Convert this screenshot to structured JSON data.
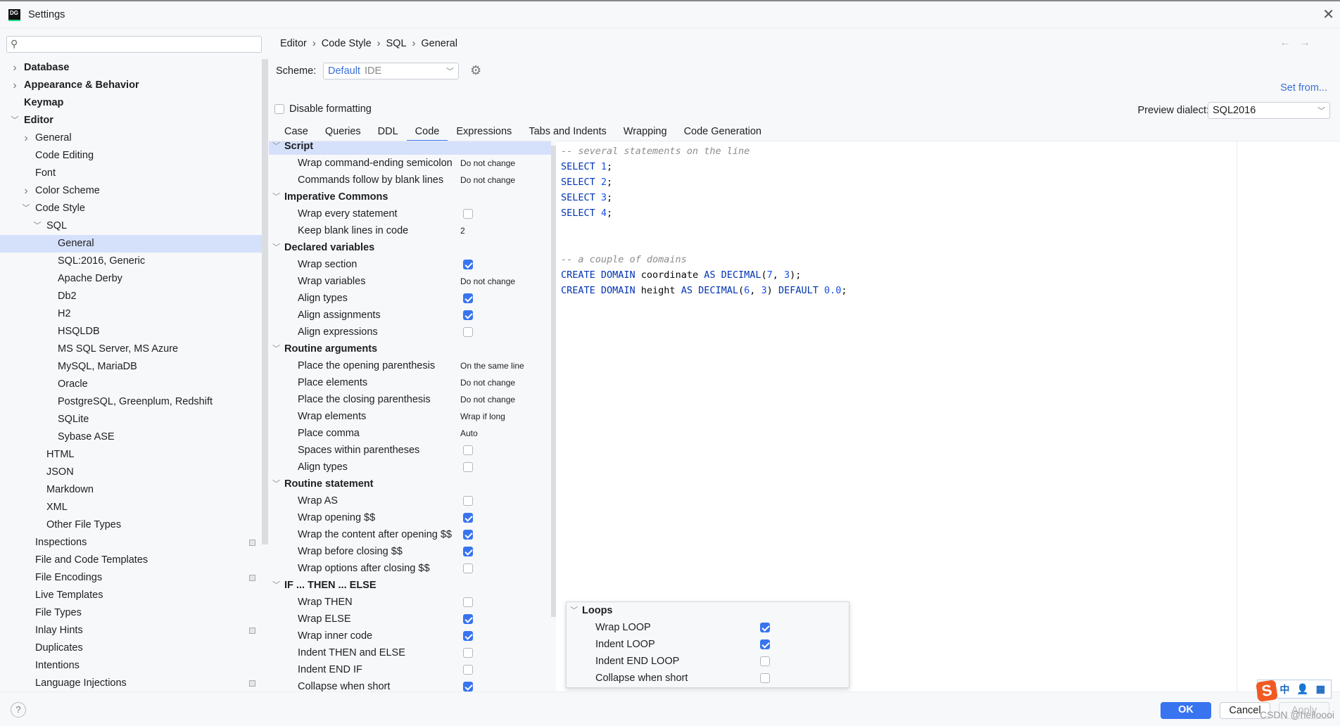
{
  "window": {
    "title": "Settings",
    "app_icon": "DG"
  },
  "search": {
    "placeholder": ""
  },
  "breadcrumb": [
    "Editor",
    "Code Style",
    "SQL",
    "General"
  ],
  "sidebar": {
    "items": [
      {
        "label": "Database",
        "level": 0,
        "arrow": "collapsed",
        "bold": true
      },
      {
        "label": "Appearance & Behavior",
        "level": 0,
        "arrow": "collapsed",
        "bold": true
      },
      {
        "label": "Keymap",
        "level": 0,
        "arrow": "none",
        "bold": true
      },
      {
        "label": "Editor",
        "level": 0,
        "arrow": "expanded",
        "bold": true
      },
      {
        "label": "General",
        "level": 1,
        "arrow": "collapsed"
      },
      {
        "label": "Code Editing",
        "level": 1,
        "arrow": "none"
      },
      {
        "label": "Font",
        "level": 1,
        "arrow": "none"
      },
      {
        "label": "Color Scheme",
        "level": 1,
        "arrow": "collapsed"
      },
      {
        "label": "Code Style",
        "level": 1,
        "arrow": "expanded"
      },
      {
        "label": "SQL",
        "level": 2,
        "arrow": "expanded"
      },
      {
        "label": "General",
        "level": 3,
        "arrow": "none",
        "selected": true
      },
      {
        "label": "SQL:2016, Generic",
        "level": 3,
        "arrow": "none"
      },
      {
        "label": "Apache Derby",
        "level": 3,
        "arrow": "none"
      },
      {
        "label": "Db2",
        "level": 3,
        "arrow": "none"
      },
      {
        "label": "H2",
        "level": 3,
        "arrow": "none"
      },
      {
        "label": "HSQLDB",
        "level": 3,
        "arrow": "none"
      },
      {
        "label": "MS SQL Server, MS Azure",
        "level": 3,
        "arrow": "none"
      },
      {
        "label": "MySQL, MariaDB",
        "level": 3,
        "arrow": "none"
      },
      {
        "label": "Oracle",
        "level": 3,
        "arrow": "none"
      },
      {
        "label": "PostgreSQL, Greenplum, Redshift",
        "level": 3,
        "arrow": "none"
      },
      {
        "label": "SQLite",
        "level": 3,
        "arrow": "none"
      },
      {
        "label": "Sybase ASE",
        "level": 3,
        "arrow": "none"
      },
      {
        "label": "HTML",
        "level": 2,
        "arrow": "none"
      },
      {
        "label": "JSON",
        "level": 2,
        "arrow": "none"
      },
      {
        "label": "Markdown",
        "level": 2,
        "arrow": "none"
      },
      {
        "label": "XML",
        "level": 2,
        "arrow": "none"
      },
      {
        "label": "Other File Types",
        "level": 2,
        "arrow": "none"
      },
      {
        "label": "Inspections",
        "level": 1,
        "arrow": "none",
        "badge": true
      },
      {
        "label": "File and Code Templates",
        "level": 1,
        "arrow": "none"
      },
      {
        "label": "File Encodings",
        "level": 1,
        "arrow": "none",
        "badge": true
      },
      {
        "label": "Live Templates",
        "level": 1,
        "arrow": "none"
      },
      {
        "label": "File Types",
        "level": 1,
        "arrow": "none"
      },
      {
        "label": "Inlay Hints",
        "level": 1,
        "arrow": "none",
        "badge": true
      },
      {
        "label": "Duplicates",
        "level": 1,
        "arrow": "none"
      },
      {
        "label": "Intentions",
        "level": 1,
        "arrow": "none"
      },
      {
        "label": "Language Injections",
        "level": 1,
        "arrow": "none",
        "badge": true
      }
    ]
  },
  "scheme": {
    "label": "Scheme:",
    "name": "Default",
    "type": "IDE"
  },
  "set_from": "Set from...",
  "disable_formatting": {
    "label": "Disable formatting",
    "checked": false
  },
  "preview_dialect": {
    "label": "Preview dialect:",
    "value": "SQL2016"
  },
  "tabs": [
    {
      "label": "Case"
    },
    {
      "label": "Queries"
    },
    {
      "label": "DDL"
    },
    {
      "label": "Code",
      "active": true
    },
    {
      "label": "Expressions"
    },
    {
      "label": "Tabs and Indents"
    },
    {
      "label": "Wrapping"
    },
    {
      "label": "Code Generation"
    }
  ],
  "options": [
    {
      "group": "Script"
    },
    {
      "label": "Wrap command-ending semicolon",
      "value": "Do not change"
    },
    {
      "label": "Commands follow by blank lines",
      "value": "Do not change"
    },
    {
      "group": "Imperative Commons"
    },
    {
      "label": "Wrap every statement",
      "checked": false
    },
    {
      "label": "Keep blank lines in code",
      "value": "2"
    },
    {
      "group": "Declared variables"
    },
    {
      "label": "Wrap section",
      "checked": true
    },
    {
      "label": "Wrap variables",
      "value": "Do not change"
    },
    {
      "label": "Align types",
      "checked": true
    },
    {
      "label": "Align assignments",
      "checked": true
    },
    {
      "label": "Align expressions",
      "checked": false
    },
    {
      "group": "Routine arguments"
    },
    {
      "label": "Place the opening parenthesis",
      "value": "On the same line"
    },
    {
      "label": "Place elements",
      "value": "Do not change"
    },
    {
      "label": "Place the closing parenthesis",
      "value": "Do not change"
    },
    {
      "label": "Wrap elements",
      "value": "Wrap if long"
    },
    {
      "label": "Place comma",
      "value": "Auto"
    },
    {
      "label": "Spaces within parentheses",
      "checked": false
    },
    {
      "label": "Align types",
      "checked": false
    },
    {
      "group": "Routine statement"
    },
    {
      "label": "Wrap AS",
      "checked": false
    },
    {
      "label": "Wrap opening $$",
      "checked": true
    },
    {
      "label": "Wrap the content after opening $$",
      "checked": true
    },
    {
      "label": "Wrap before closing $$",
      "checked": true
    },
    {
      "label": "Wrap options after closing $$",
      "checked": false
    },
    {
      "group": "IF ... THEN ... ELSE"
    },
    {
      "label": "Wrap THEN",
      "checked": false
    },
    {
      "label": "Wrap ELSE",
      "checked": true
    },
    {
      "label": "Wrap inner code",
      "checked": true
    },
    {
      "label": "Indent THEN and ELSE",
      "checked": false
    },
    {
      "label": "Indent END IF",
      "checked": false
    },
    {
      "label": "Collapse when short",
      "checked": true
    }
  ],
  "loops_popup": [
    {
      "group": "Loops"
    },
    {
      "label": "Wrap LOOP",
      "checked": true
    },
    {
      "label": "Indent LOOP",
      "checked": true
    },
    {
      "label": "Indent END LOOP",
      "checked": false
    },
    {
      "label": "Collapse when short",
      "checked": false
    }
  ],
  "preview_code": [
    [
      {
        "t": "cm",
        "v": "-- several statements on the line"
      }
    ],
    [
      {
        "t": "kw",
        "v": "SELECT "
      },
      {
        "t": "num",
        "v": "1"
      },
      {
        "t": "id",
        "v": ";"
      }
    ],
    [
      {
        "t": "kw",
        "v": "SELECT "
      },
      {
        "t": "num",
        "v": "2"
      },
      {
        "t": "id",
        "v": ";"
      }
    ],
    [
      {
        "t": "kw",
        "v": "SELECT "
      },
      {
        "t": "num",
        "v": "3"
      },
      {
        "t": "id",
        "v": ";"
      }
    ],
    [
      {
        "t": "kw",
        "v": "SELECT "
      },
      {
        "t": "num",
        "v": "4"
      },
      {
        "t": "id",
        "v": ";"
      }
    ],
    [],
    [],
    [
      {
        "t": "cm",
        "v": "-- a couple of domains"
      }
    ],
    [
      {
        "t": "kw",
        "v": "CREATE DOMAIN "
      },
      {
        "t": "id",
        "v": "coordinate "
      },
      {
        "t": "kw",
        "v": "AS DECIMAL"
      },
      {
        "t": "id",
        "v": "("
      },
      {
        "t": "num",
        "v": "7"
      },
      {
        "t": "id",
        "v": ", "
      },
      {
        "t": "num",
        "v": "3"
      },
      {
        "t": "id",
        "v": ");"
      }
    ],
    [
      {
        "t": "kw",
        "v": "CREATE DOMAIN "
      },
      {
        "t": "id",
        "v": "height "
      },
      {
        "t": "kw",
        "v": "AS DECIMAL"
      },
      {
        "t": "id",
        "v": "("
      },
      {
        "t": "num",
        "v": "6"
      },
      {
        "t": "id",
        "v": ", "
      },
      {
        "t": "num",
        "v": "3"
      },
      {
        "t": "id",
        "v": ") "
      },
      {
        "t": "kw",
        "v": "DEFAULT "
      },
      {
        "t": "num",
        "v": "0.0"
      },
      {
        "t": "id",
        "v": ";"
      }
    ]
  ],
  "footer": {
    "ok": "OK",
    "cancel": "Cancel",
    "apply": "Apply",
    "help": "?"
  },
  "ime": {
    "logo": "S",
    "lang": "中"
  },
  "watermark": "CSDN @helloooi",
  "colors": {
    "accent": "#3874f0",
    "selection": "#d5e1fb",
    "keyword": "#0033b3",
    "number": "#1750eb",
    "comment": "#8c8c8c"
  }
}
